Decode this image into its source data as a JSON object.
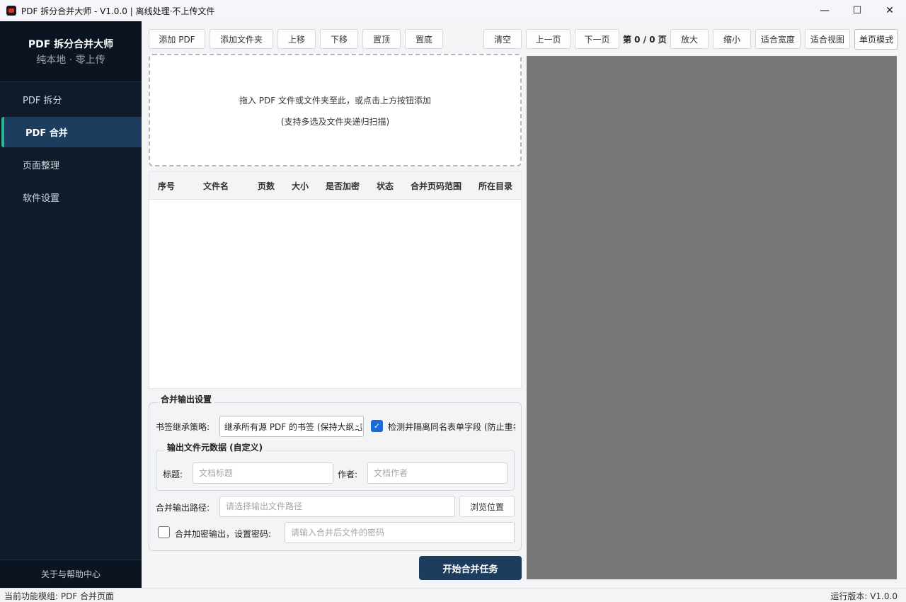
{
  "window": {
    "title": "PDF 拆分合并大师 - V1.0.0 | 离线处理·不上传文件",
    "minimize": "—",
    "maximize": "☐",
    "close": "✕"
  },
  "sidebar": {
    "brand_title": "PDF 拆分合并大师",
    "brand_subtitle": "纯本地 · 零上传",
    "items": [
      {
        "label": "PDF 拆分"
      },
      {
        "label": "PDF 合并"
      },
      {
        "label": "页面整理"
      },
      {
        "label": "软件设置"
      }
    ],
    "help": "关于与帮助中心"
  },
  "toolbar": {
    "add_pdf": "添加 PDF",
    "add_folder": "添加文件夹",
    "move_up": "上移",
    "move_down": "下移",
    "to_top": "置顶",
    "to_bottom": "置底"
  },
  "preview_toolbar": {
    "clear": "清空",
    "prev_page": "上一页",
    "next_page": "下一页",
    "page_indicator": "第 0 / 0 页",
    "zoom_in": "放大",
    "zoom_out": "缩小",
    "fit_width": "适合宽度",
    "fit_view": "适合视图",
    "view_mode": "单页模式"
  },
  "dropzone": {
    "line1": "拖入 PDF 文件或文件夹至此，或点击上方按钮添加",
    "line2": "(支持多选及文件夹递归扫描)"
  },
  "table": {
    "columns": [
      "序号",
      "文件名",
      "页数",
      "大小",
      "是否加密",
      "状态",
      "合并页码范围",
      "所在目录"
    ],
    "rows": []
  },
  "settings": {
    "group_title": "合并输出设置",
    "bookmark_label": "书签继承策略:",
    "bookmark_value": "继承所有源 PDF 的书签 (保持大纲结构)",
    "detect_checkbox_label": "检测并隔离同名表单字段 (防止重名冲突)",
    "detect_checked": true,
    "metadata_title": "输出文件元数据 (自定义)",
    "title_label": "标题:",
    "title_placeholder": "文档标题",
    "author_label": "作者:",
    "author_placeholder": "文档作者",
    "output_label": "合并输出路径:",
    "output_placeholder": "请选择输出文件路径",
    "browse": "浏览位置",
    "encrypt_label": "合并加密输出，设置密码:",
    "encrypt_checked": false,
    "password_placeholder": "请输入合并后文件的密码",
    "start": "开始合并任务"
  },
  "status": {
    "left": "当前功能模组: PDF 合并页面",
    "right": "运行版本: V1.0.0"
  }
}
